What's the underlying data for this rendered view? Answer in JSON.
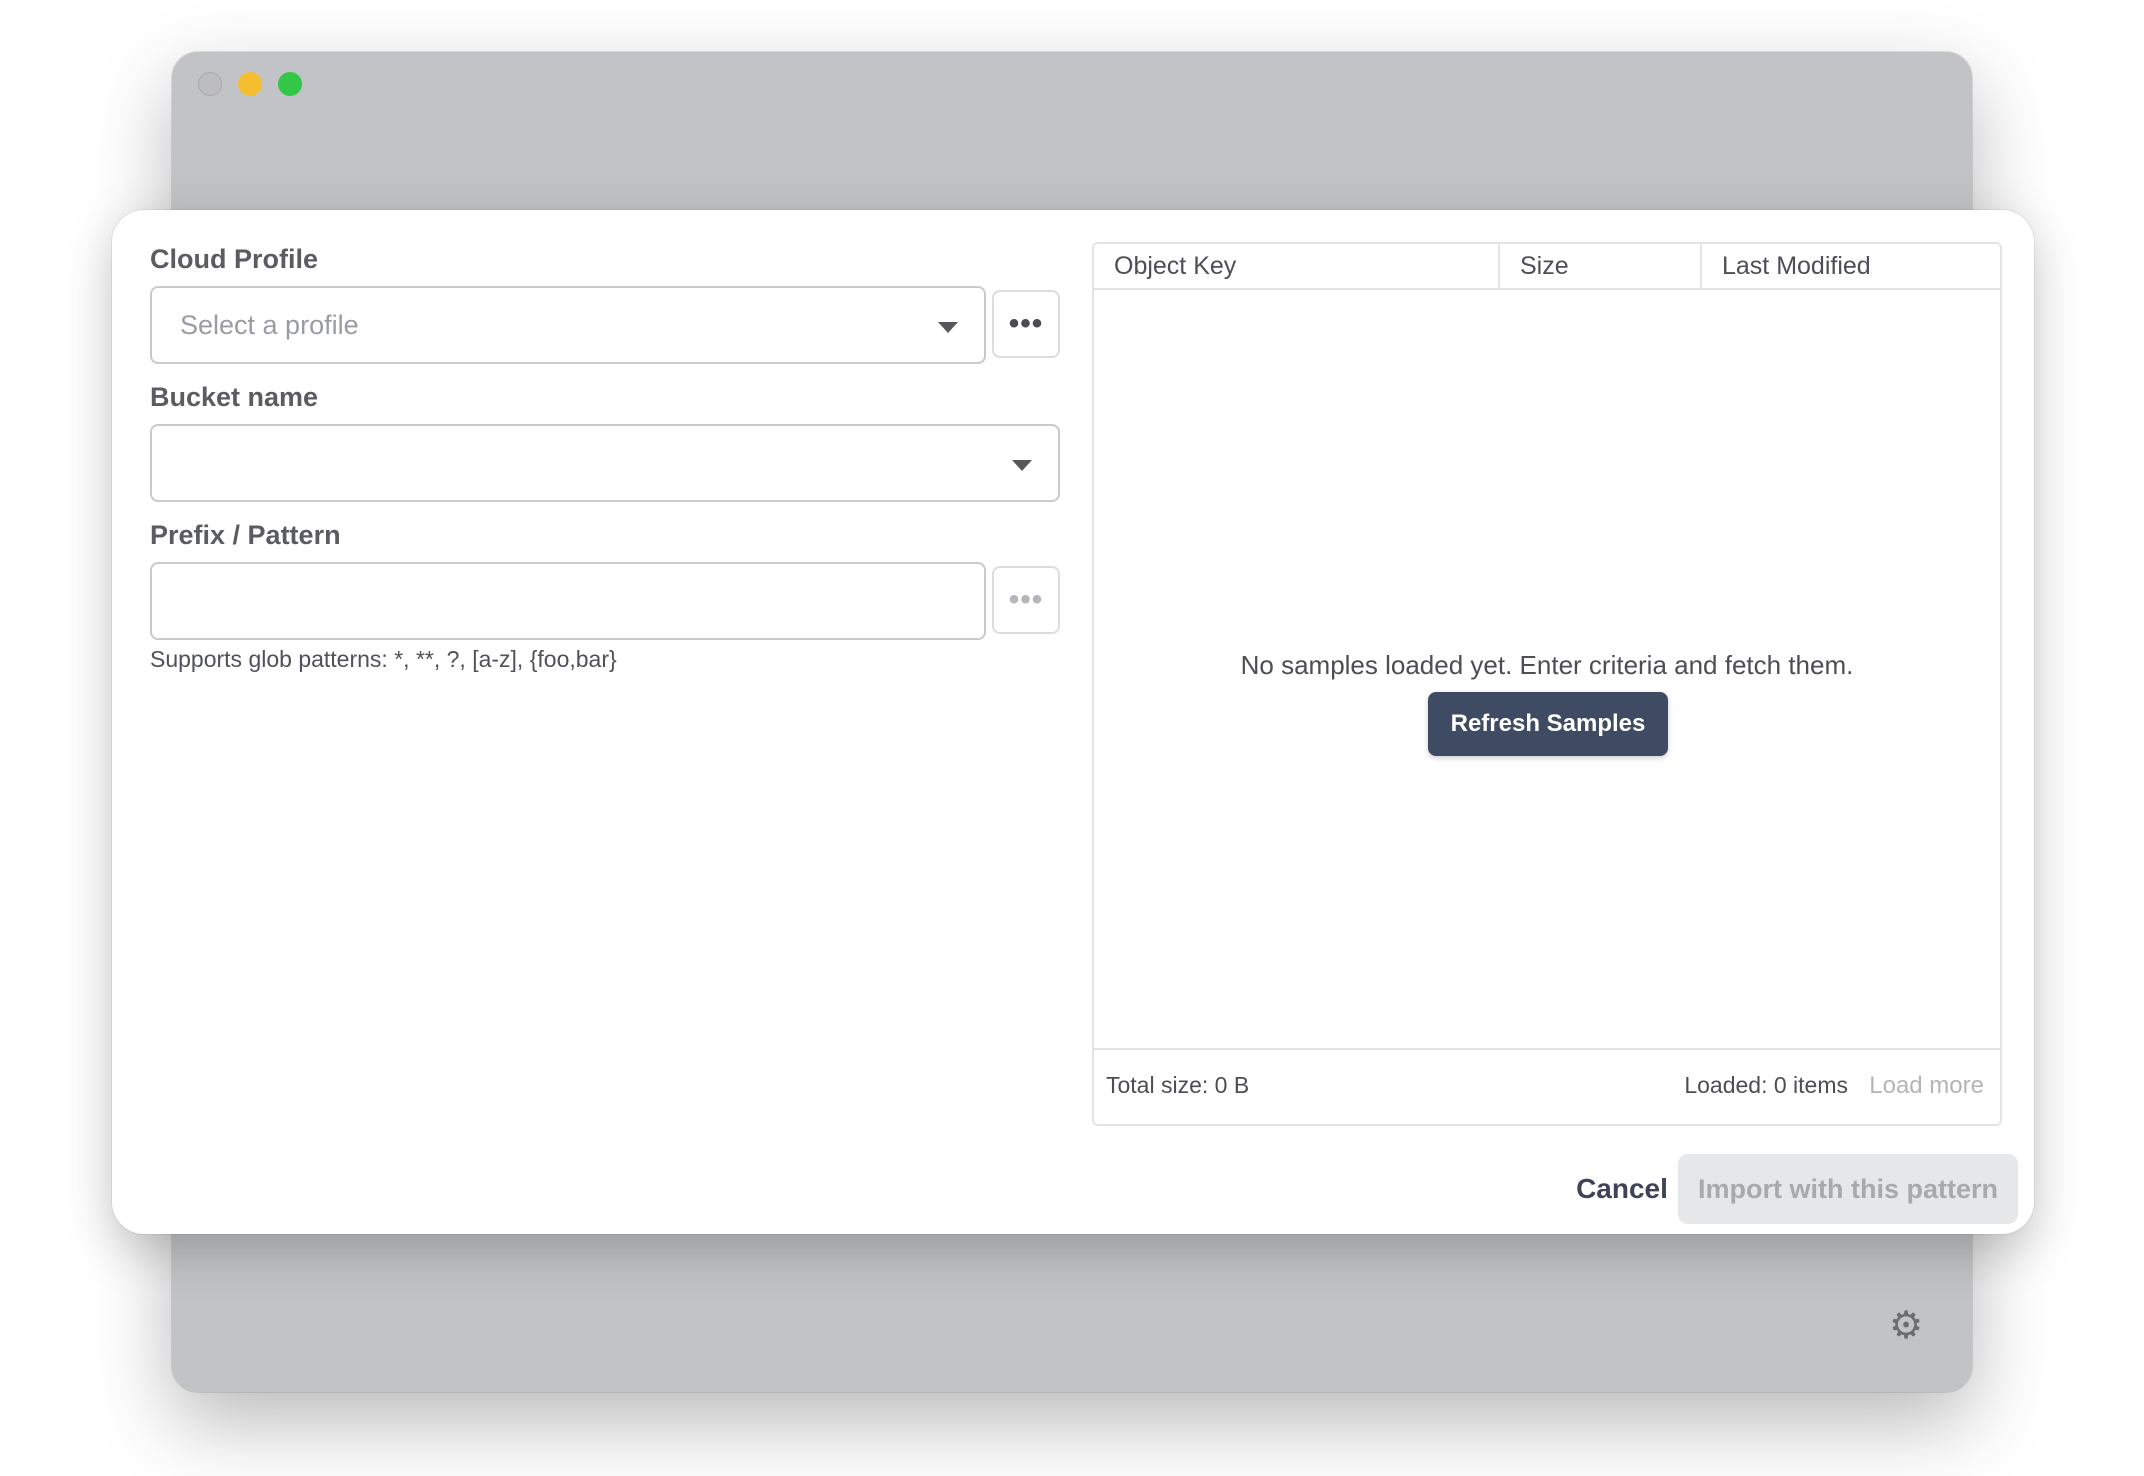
{
  "window": {
    "traffic_lights": [
      "close",
      "minimize",
      "maximize"
    ],
    "gear_icon": "gear-icon"
  },
  "form": {
    "cloud_profile": {
      "label": "Cloud Profile",
      "placeholder": "Select a profile",
      "value": ""
    },
    "bucket_name": {
      "label": "Bucket name",
      "value": ""
    },
    "prefix_pattern": {
      "label": "Prefix / Pattern",
      "value": ""
    },
    "hint": "Supports glob patterns: *, **, ?, [a-z], {foo,bar}",
    "more_label": "•••"
  },
  "samples": {
    "columns": [
      "Object Key",
      "Size",
      "Last Modified"
    ],
    "rows": [],
    "empty_message": "No samples loaded yet. Enter criteria and fetch them.",
    "refresh_label": "Refresh Samples",
    "total_size": "Total size: 0 B",
    "loaded": "Loaded: 0 items",
    "load_more": "Load more"
  },
  "actions": {
    "cancel": "Cancel",
    "import": "Import with this pattern"
  },
  "colors": {
    "primary_button": "#3f4a63",
    "disabled_button": "#e6e7e9",
    "window_bg": "#c2c3c6"
  }
}
